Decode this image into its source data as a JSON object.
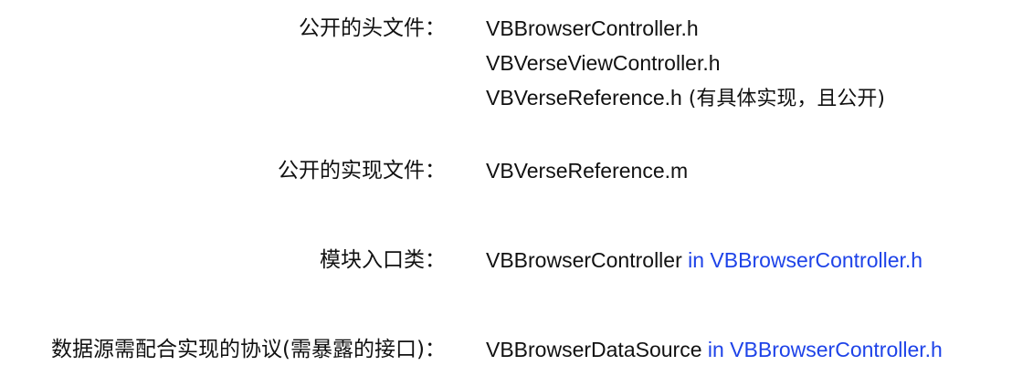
{
  "rows": [
    {
      "label": "公开的头文件：",
      "values": [
        {
          "text": "VBBrowserController.h",
          "note": "",
          "link": ""
        },
        {
          "text": "VBVerseViewController.h",
          "note": "",
          "link": ""
        },
        {
          "text": "VBVerseReference.h",
          "note": " (有具体实现，且公开)",
          "link": ""
        }
      ]
    },
    {
      "label": "公开的实现文件：",
      "values": [
        {
          "text": "VBVerseReference.m",
          "note": "",
          "link": ""
        }
      ]
    },
    {
      "label": "模块入口类：",
      "values": [
        {
          "text": "VBBrowserController",
          "note": "",
          "link": " in VBBrowserController.h"
        }
      ]
    },
    {
      "label": "数据源需配合实现的协议(需暴露的接口)：",
      "values": [
        {
          "text": "VBBrowserDataSource",
          "note": "",
          "link": " in VBBrowserController.h"
        }
      ]
    }
  ],
  "colors": {
    "text": "#111111",
    "link": "#1e43e8",
    "background": "#ffffff"
  }
}
